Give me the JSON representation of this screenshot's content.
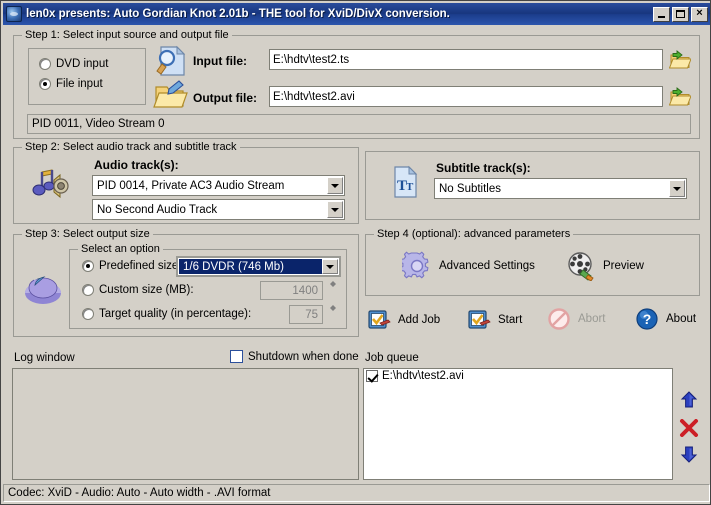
{
  "window": {
    "title": "len0x presents: Auto Gordian Knot 2.01b - THE tool for XviD/DivX conversion.",
    "app_icon": "app-globe-icon",
    "minimize_label": "_",
    "maximize_label": "",
    "close_label": "×"
  },
  "step1": {
    "legend": "Step 1: Select input source and output file",
    "source_options": [
      {
        "label": "DVD input",
        "selected": false
      },
      {
        "label": "File input",
        "selected": true
      }
    ],
    "input_icon": "document-search-icon",
    "output_icon": "folder-pen-icon",
    "input_label": "Input file:",
    "input_value": "E:\\hdtv\\test2.ts",
    "input_placeholder": "",
    "output_label": "Output file:",
    "output_value": "E:\\hdtv\\test2.avi",
    "output_placeholder": "",
    "browse_icon": "open-folder-icon",
    "stream_info": "PID 0011, Video Stream 0"
  },
  "step2": {
    "legend": "Step 2: Select audio track and subtitle track",
    "audio_icon": "music-speaker-icon",
    "audio_label": "Audio track(s):",
    "audio_track_1": "PID 0014, Private AC3 Audio Stream",
    "audio_track_2": "No Second Audio Track",
    "subtitle_icon": "subtitle-text-icon",
    "subtitle_label": "Subtitle track(s):",
    "subtitle_track": "No Subtitles"
  },
  "step3": {
    "legend": "Step 3: Select output size",
    "pie_icon": "pie-chart-icon",
    "option_legend": "Select an option",
    "options": [
      {
        "label": "Predefined size:",
        "selected": true
      },
      {
        "label": "Custom size (MB):",
        "selected": false
      },
      {
        "label": "Target quality (in percentage):",
        "selected": false
      }
    ],
    "predefined_value": "1/6 DVDR (746 Mb)",
    "custom_size_value": "1400",
    "target_quality_value": "75"
  },
  "step4": {
    "legend": "Step 4 (optional): advanced parameters",
    "advanced_icon": "gear-icon",
    "advanced_label": "Advanced Settings",
    "preview_icon": "film-reel-icon",
    "preview_label": "Preview"
  },
  "actions": [
    {
      "label": "Add Job",
      "icon": "checkbox-pen-icon",
      "enabled": true
    },
    {
      "label": "Start",
      "icon": "checkbox-pen-icon",
      "enabled": true
    },
    {
      "label": "Abort",
      "icon": "no-entry-icon",
      "enabled": false
    },
    {
      "label": "About",
      "icon": "question-circle-icon",
      "enabled": true
    }
  ],
  "log": {
    "label": "Log window",
    "content": "",
    "shutdown_label": "Shutdown when done",
    "shutdown_checked": false
  },
  "queue": {
    "label": "Job queue",
    "items": [
      {
        "label": "E:\\hdtv\\test2.avi",
        "checked": true
      }
    ],
    "move_up_icon": "arrow-up-icon",
    "delete_icon": "red-x-icon",
    "move_down_icon": "arrow-down-icon"
  },
  "statusbar": {
    "text": "Codec: XviD -  Audio: Auto -  Auto width - .AVI format"
  },
  "colors": {
    "face": "#d4d0c8",
    "title_blue": "#1b3d8c",
    "highlight": "#0a246a",
    "accent_blue": "#2b4f9b",
    "danger_red": "#cc1f26"
  }
}
